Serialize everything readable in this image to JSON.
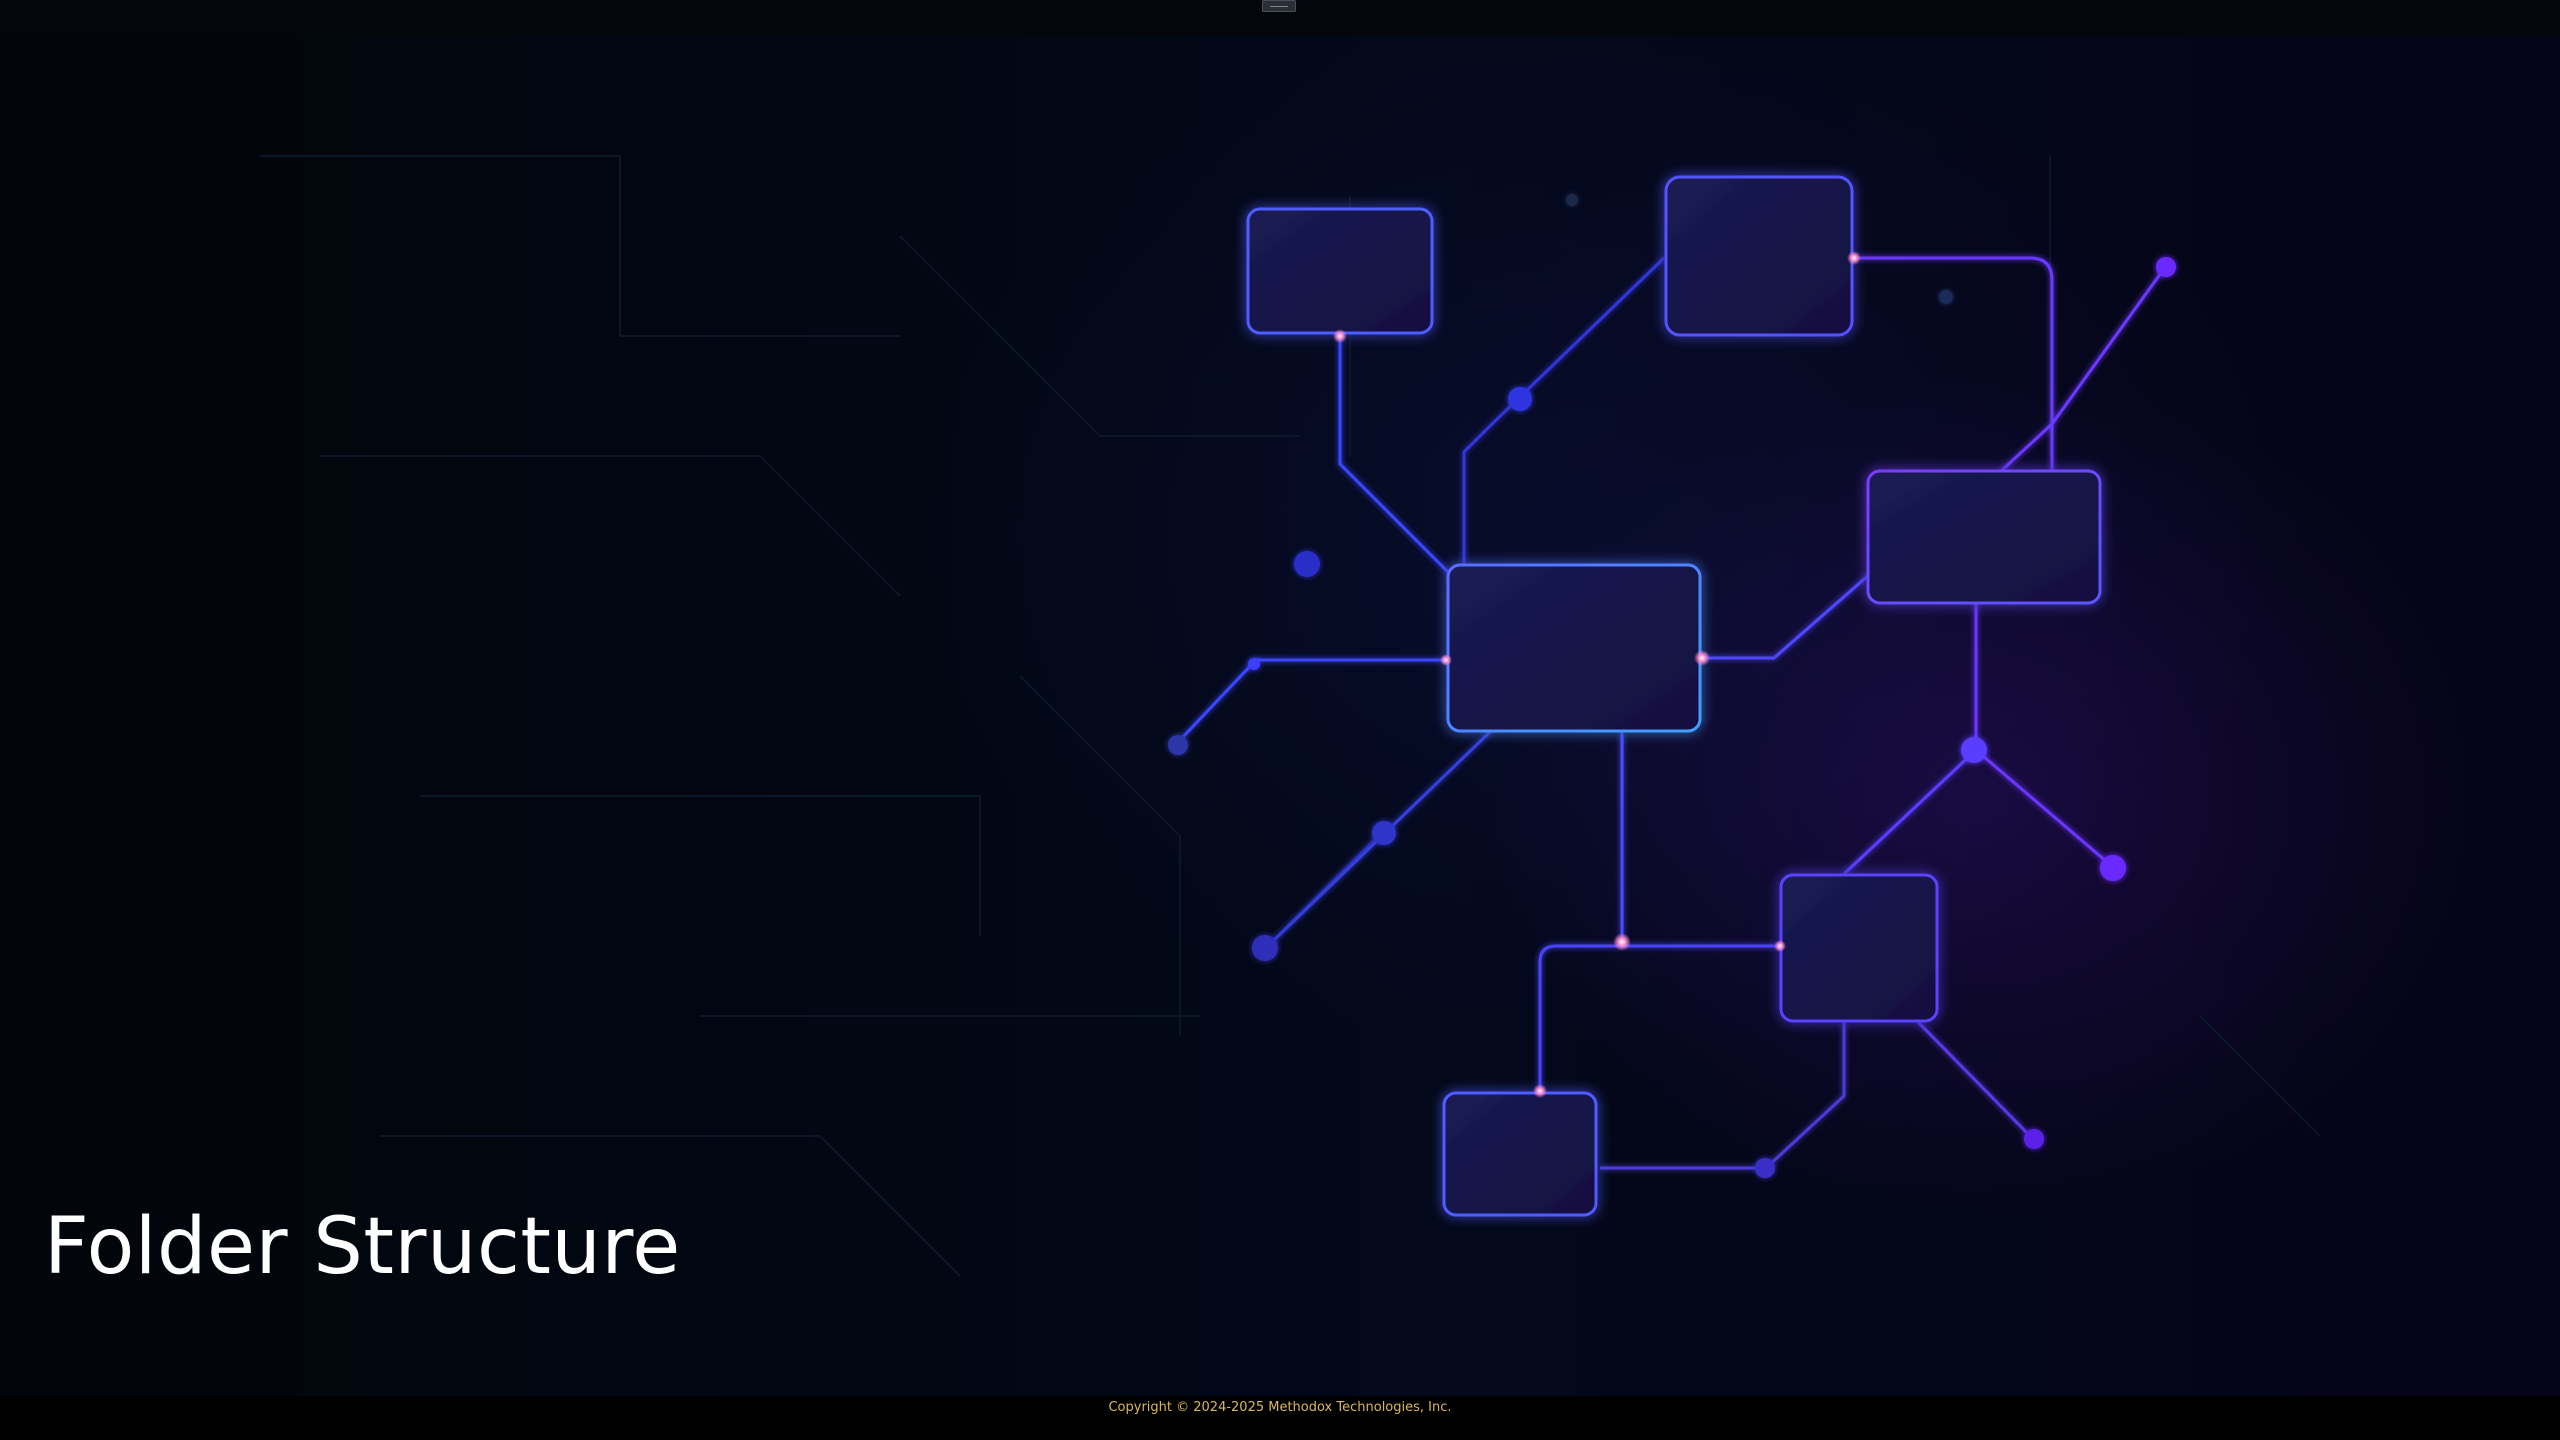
{
  "slide": {
    "title": "Folder Structure"
  },
  "footer": {
    "copyright": "Copyright © 2024-2025 Methodox Technologies, Inc."
  },
  "colors": {
    "background": "#03081a",
    "node_fill": "#15164a",
    "node_border_blue": "#4d6bff",
    "node_border_violet": "#6a3cff",
    "connector": "#3b3bff",
    "title_text": "#ffffff",
    "copyright_text": "#d8b85a"
  },
  "icons": {
    "top_handle": "window-drag-handle-icon"
  }
}
